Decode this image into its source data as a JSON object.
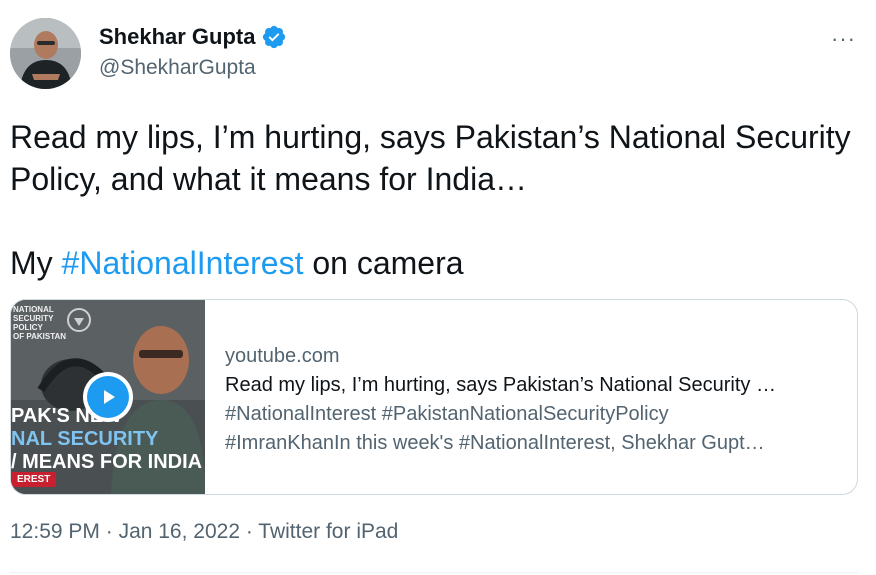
{
  "author": {
    "name": "Shekhar Gupta",
    "handle": "@ShekharGupta",
    "verified": true
  },
  "menu": {
    "more_label": "···"
  },
  "tweet": {
    "line1": "Read my lips, I’m hurting, says Pakistan’s National Security Policy, and what it means for India…",
    "line2_prefix": "My ",
    "line2_hashtag": "#NationalInterest",
    "line2_suffix": " on camera"
  },
  "card": {
    "domain": "youtube.com",
    "title": "Read my lips, I’m hurting, says Pakistan’s National Security …",
    "desc_line1": "#NationalInterest #PakistanNationalSecurityPolicy",
    "desc_line2": "#ImranKhanIn this week's #NationalInterest, Shekhar Gupt…",
    "thumbnail": {
      "caption_top": "NATIONAL\nSECURITY\nPOLICY\nOF PAKISTAN",
      "headline1": "PAK'S NEW",
      "headline2": "NAL SECURITY",
      "headline3": "/ MEANS FOR INDIA",
      "tag": "EREST",
      "play_icon": "play-icon"
    }
  },
  "meta": {
    "time": "12:59 PM",
    "sep1": " · ",
    "date": "Jan 16, 2022",
    "sep2": " · ",
    "source": "Twitter for iPad"
  },
  "colors": {
    "accent": "#1d9bf0",
    "text": "#0f1419",
    "secondary": "#536471",
    "border": "#cfd9de"
  }
}
